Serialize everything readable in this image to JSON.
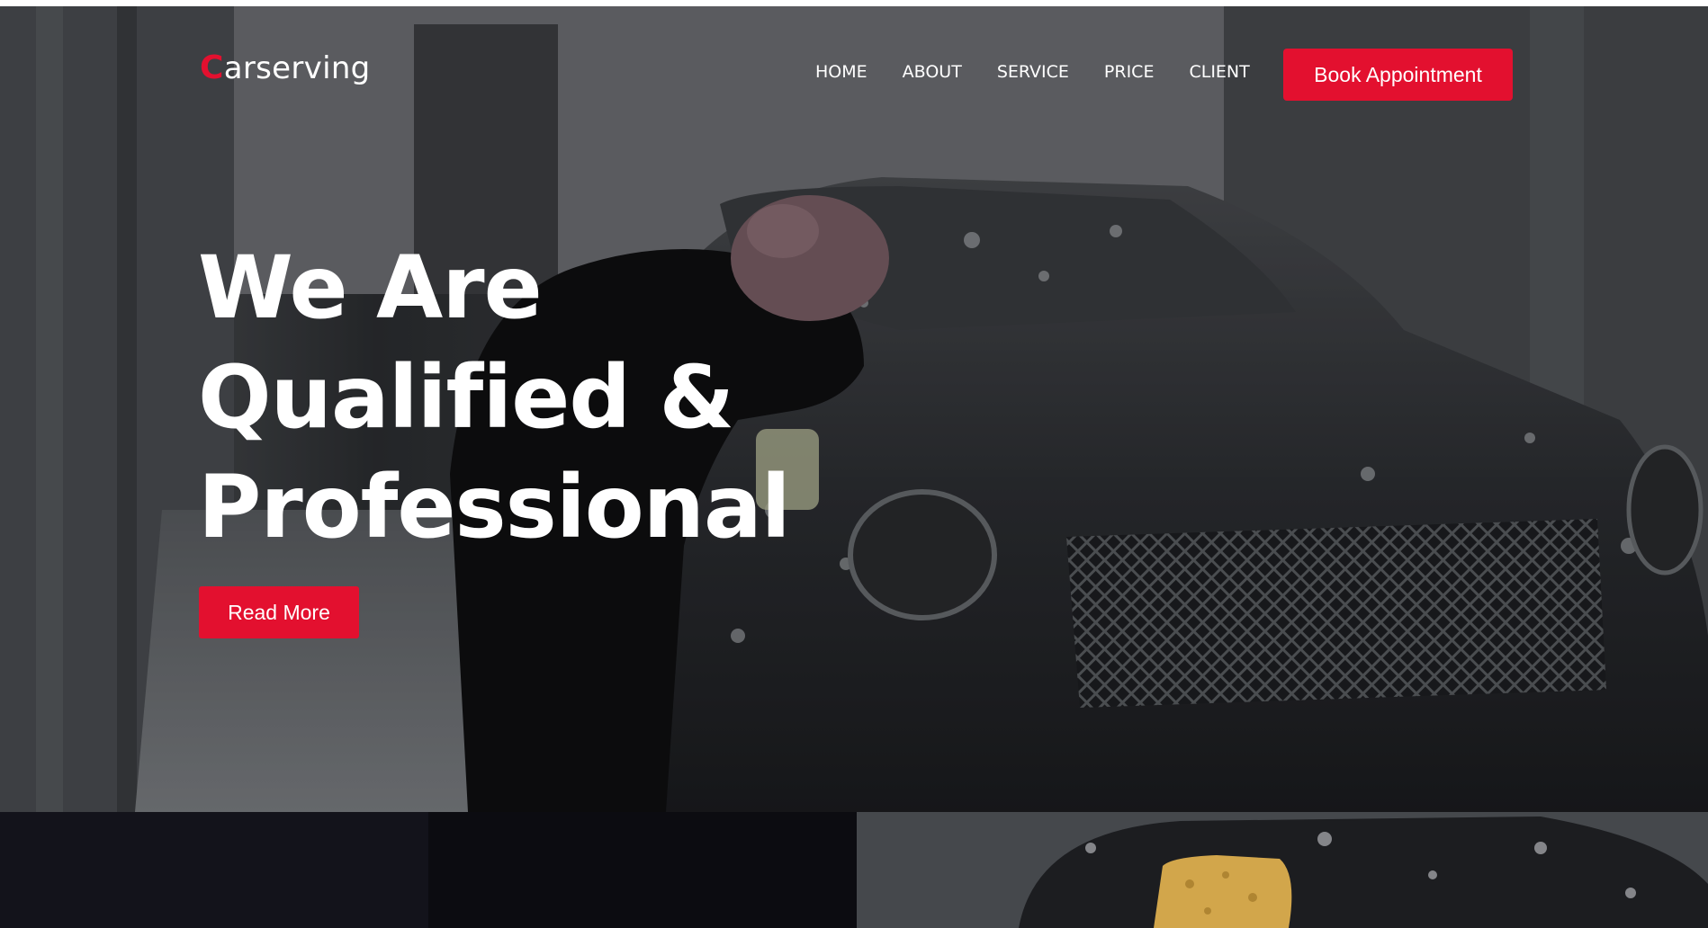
{
  "header": {
    "logo_initial": "C",
    "logo_rest": "arserving",
    "nav": [
      "HOME",
      "ABOUT",
      "SERVICE",
      "PRICE",
      "CLIENT"
    ],
    "cta_label": "Book Appointment"
  },
  "hero": {
    "title_lines": [
      "We Are",
      "Qualified &",
      "Professional"
    ],
    "button_label": "Read More"
  },
  "colors": {
    "accent": "#e3102f",
    "dark_panel_1": "#13131b",
    "dark_panel_2": "#0c0c11",
    "text": "#ffffff"
  },
  "icons": [
    "car-photo",
    "sponge-photo"
  ]
}
